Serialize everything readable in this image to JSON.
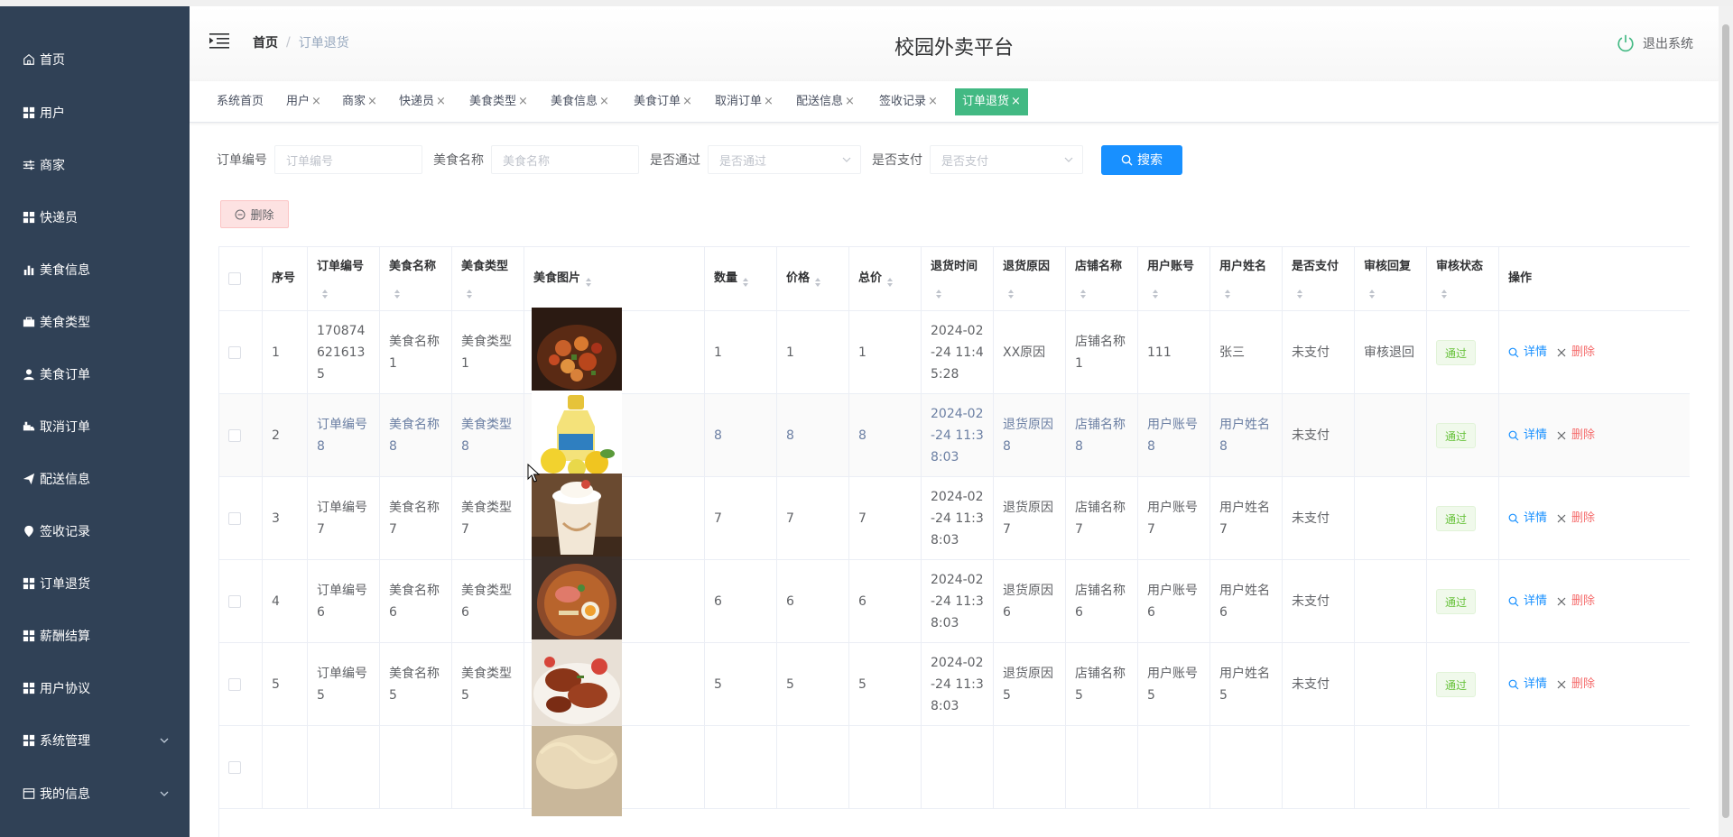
{
  "app": {
    "title": "校园外卖平台",
    "logout_label": "退出系统"
  },
  "breadcrumb": {
    "home": "首页",
    "sep": "/",
    "current": "订单退货"
  },
  "sidebar": {
    "items": [
      {
        "label": "首页",
        "icon": "home-icon"
      },
      {
        "label": "用户",
        "icon": "grid-icon"
      },
      {
        "label": "商家",
        "icon": "sliders-icon"
      },
      {
        "label": "快递员",
        "icon": "grid-icon"
      },
      {
        "label": "美食信息",
        "icon": "bar-chart-icon"
      },
      {
        "label": "美食类型",
        "icon": "briefcase-icon"
      },
      {
        "label": "美食订单",
        "icon": "user-icon"
      },
      {
        "label": "取消订单",
        "icon": "truck-icon"
      },
      {
        "label": "配送信息",
        "icon": "send-icon"
      },
      {
        "label": "签收记录",
        "icon": "location-icon"
      },
      {
        "label": "订单退货",
        "icon": "grid-icon"
      },
      {
        "label": "薪酬结算",
        "icon": "grid-icon"
      },
      {
        "label": "用户协议",
        "icon": "grid-icon"
      },
      {
        "label": "系统管理",
        "icon": "grid-icon",
        "expandable": true
      },
      {
        "label": "我的信息",
        "icon": "window-icon",
        "expandable": true
      }
    ]
  },
  "tags": [
    {
      "label": "系统首页",
      "closable": false
    },
    {
      "label": "用户",
      "closable": true
    },
    {
      "label": "商家",
      "closable": true
    },
    {
      "label": "快递员",
      "closable": true
    },
    {
      "label": "美食类型",
      "closable": true
    },
    {
      "label": "美食信息",
      "closable": true
    },
    {
      "label": "美食订单",
      "closable": true
    },
    {
      "label": "取消订单",
      "closable": true
    },
    {
      "label": "配送信息",
      "closable": true
    },
    {
      "label": "签收记录",
      "closable": true
    },
    {
      "label": "订单退货",
      "closable": true,
      "active": true
    }
  ],
  "tag_close_glyph": "×",
  "search": {
    "order_no": {
      "label": "订单编号",
      "placeholder": "订单编号"
    },
    "food_name": {
      "label": "美食名称",
      "placeholder": "美食名称"
    },
    "passed": {
      "label": "是否通过",
      "placeholder": "是否通过"
    },
    "paid": {
      "label": "是否支付",
      "placeholder": "是否支付"
    },
    "button_label": "搜索"
  },
  "bulk_delete_label": "删除",
  "table": {
    "columns": [
      "序号",
      "订单编号",
      "美食名称",
      "美食类型",
      "美食图片",
      "数量",
      "价格",
      "总价",
      "退货时间",
      "退货原因",
      "店铺名称",
      "用户账号",
      "用户姓名",
      "是否支付",
      "审核回复",
      "审核状态",
      "操作"
    ],
    "detail_label": "详情",
    "delete_label": "删除",
    "rows": [
      {
        "idx": "1",
        "order_no": "1708746216135",
        "food_name": "美食名称1",
        "food_type": "美食类型1",
        "image": "spicy-chicken-dish",
        "qty": "1",
        "price": "1",
        "total": "1",
        "return_time": "2024-02-24 11:45:28",
        "reason": "XX原因",
        "shop": "店铺名称1",
        "account": "111",
        "user_name": "张三",
        "paid": "未支付",
        "reply": "审核退回",
        "status": "通过"
      },
      {
        "idx": "2",
        "order_no": "订单编号8",
        "food_name": "美食名称8",
        "food_type": "美食类型8",
        "image": "lemon-juice-bottle",
        "qty": "8",
        "price": "8",
        "total": "8",
        "return_time": "2024-02-24 11:38:03",
        "reason": "退货原因8",
        "shop": "店铺名称8",
        "account": "用户账号8",
        "user_name": "用户姓名8",
        "paid": "未支付",
        "reply": "",
        "status": "通过"
      },
      {
        "idx": "3",
        "order_no": "订单编号7",
        "food_name": "美食名称7",
        "food_type": "美食类型7",
        "image": "milkshake-cup",
        "qty": "7",
        "price": "7",
        "total": "7",
        "return_time": "2024-02-24 11:38:03",
        "reason": "退货原因7",
        "shop": "店铺名称7",
        "account": "用户账号7",
        "user_name": "用户姓名7",
        "paid": "未支付",
        "reply": "",
        "status": "通过"
      },
      {
        "idx": "4",
        "order_no": "订单编号6",
        "food_name": "美食名称6",
        "food_type": "美食类型6",
        "image": "ramen-bowl",
        "qty": "6",
        "price": "6",
        "total": "6",
        "return_time": "2024-02-24 11:38:03",
        "reason": "退货原因6",
        "shop": "店铺名称6",
        "account": "用户账号6",
        "user_name": "用户姓名6",
        "paid": "未支付",
        "reply": "",
        "status": "通过"
      },
      {
        "idx": "5",
        "order_no": "订单编号5",
        "food_name": "美食名称5",
        "food_type": "美食类型5",
        "image": "roast-meat-plate",
        "qty": "5",
        "price": "5",
        "total": "5",
        "return_time": "2024-02-24 11:38:03",
        "reason": "退货原因5",
        "shop": "店铺名称5",
        "account": "用户账号5",
        "user_name": "用户姓名5",
        "paid": "未支付",
        "reply": "",
        "status": "通过"
      },
      {
        "idx": "",
        "order_no": "",
        "food_name": "",
        "food_type": "",
        "image": "noodle-dish",
        "qty": "",
        "price": "",
        "total": "",
        "return_time": "",
        "reason": "",
        "shop": "",
        "account": "",
        "user_name": "",
        "paid": "",
        "reply": "",
        "status": ""
      }
    ]
  },
  "colors": {
    "sidebar_bg": "#304156",
    "active_tag": "#42b983",
    "primary": "#1890ff",
    "danger": "#f56c6c",
    "success": "#67c23a"
  }
}
